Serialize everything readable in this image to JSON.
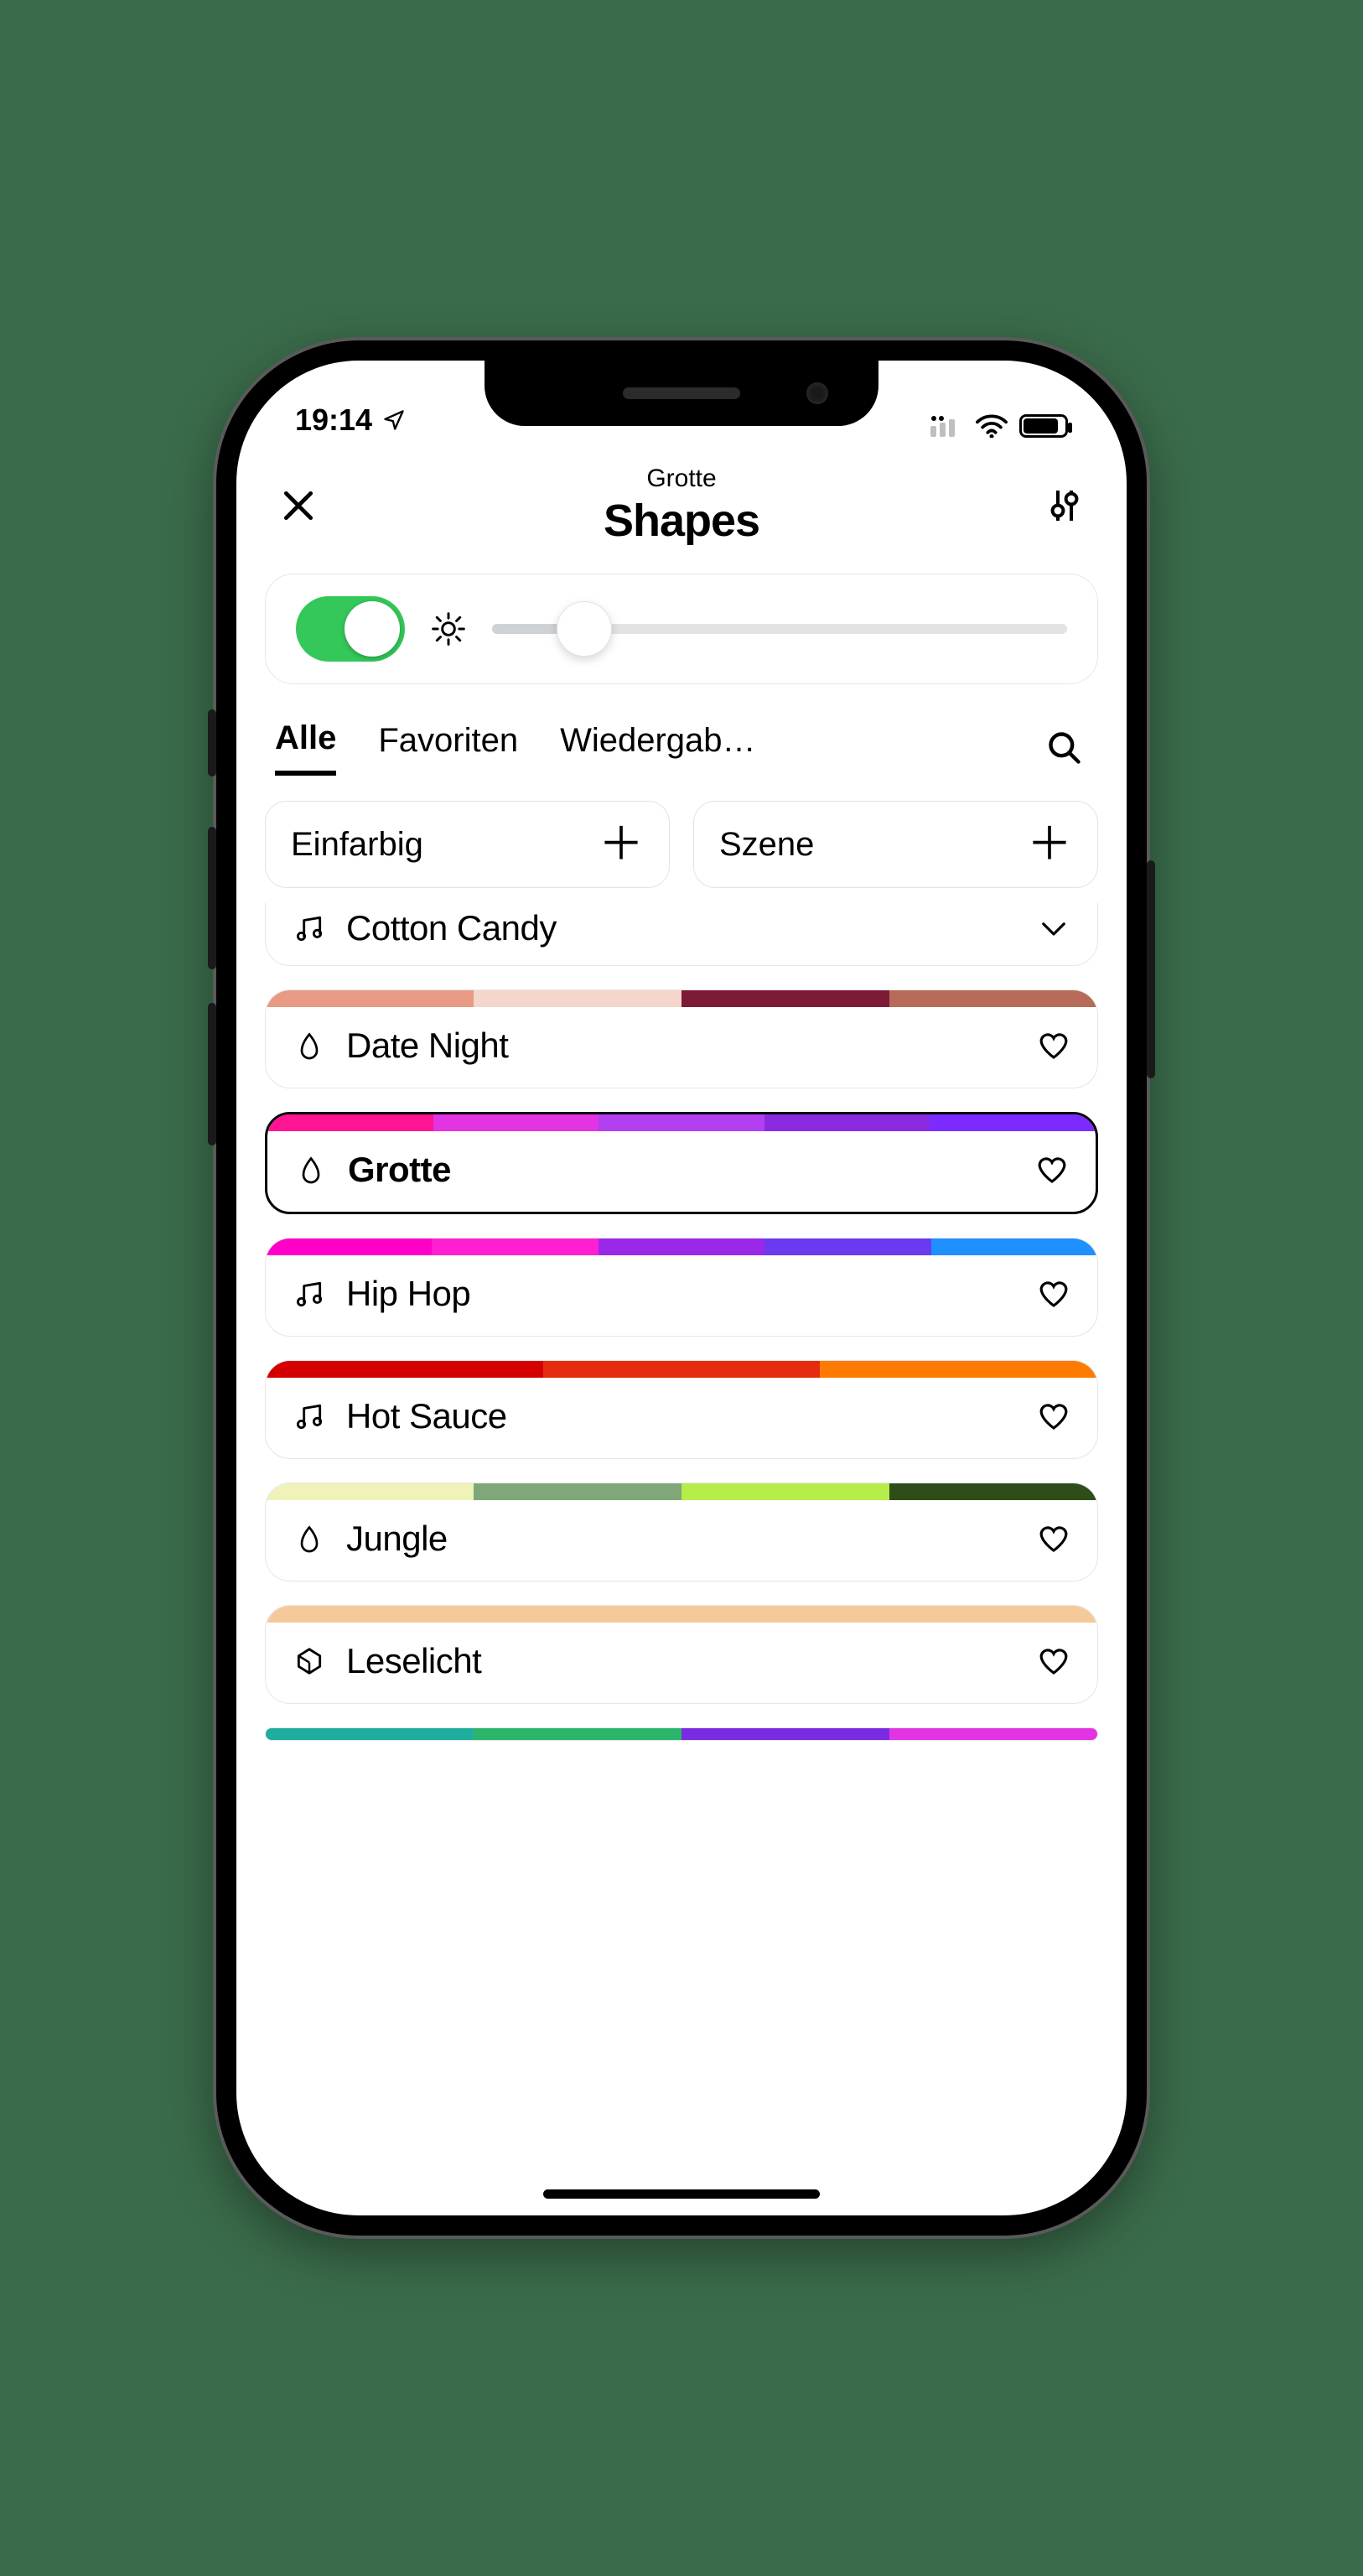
{
  "status": {
    "time": "19:14"
  },
  "header": {
    "subtitle": "Grotte",
    "title": "Shapes"
  },
  "controls": {
    "power_on": true,
    "brightness_pct": 16
  },
  "tabs": {
    "items": [
      "Alle",
      "Favoriten",
      "Wiedergab…"
    ],
    "active_index": 0
  },
  "chips": {
    "single_color": "Einfarbig",
    "scene": "Szene"
  },
  "scenes": [
    {
      "name": "Cotton Candy",
      "type": "music",
      "fav": false,
      "expanded": true,
      "colors": []
    },
    {
      "name": "Date Night",
      "type": "motion",
      "fav": false,
      "colors": [
        "#e89a85",
        "#f4d6cd",
        "#7d1a35",
        "#b76b58"
      ]
    },
    {
      "name": "Grotte",
      "type": "motion",
      "fav": false,
      "selected": true,
      "colors": [
        "#ff1493",
        "#e334e3",
        "#b23ff0",
        "#8a2be2",
        "#7b2bff"
      ]
    },
    {
      "name": "Hip Hop",
      "type": "music",
      "fav": false,
      "colors": [
        "#ff00c8",
        "#ff1fd1",
        "#9a28e8",
        "#6a3af0",
        "#1e90ff"
      ]
    },
    {
      "name": "Hot Sauce",
      "type": "music",
      "fav": false,
      "colors": [
        "#d40000",
        "#e52b0f",
        "#ff7a00"
      ]
    },
    {
      "name": "Jungle",
      "type": "motion",
      "fav": false,
      "colors": [
        "#f0f3b8",
        "#7fa77a",
        "#b6ed48",
        "#2e4d18"
      ]
    },
    {
      "name": "Leselicht",
      "type": "static",
      "fav": false,
      "colors": [
        "#f6c99a"
      ]
    }
  ]
}
